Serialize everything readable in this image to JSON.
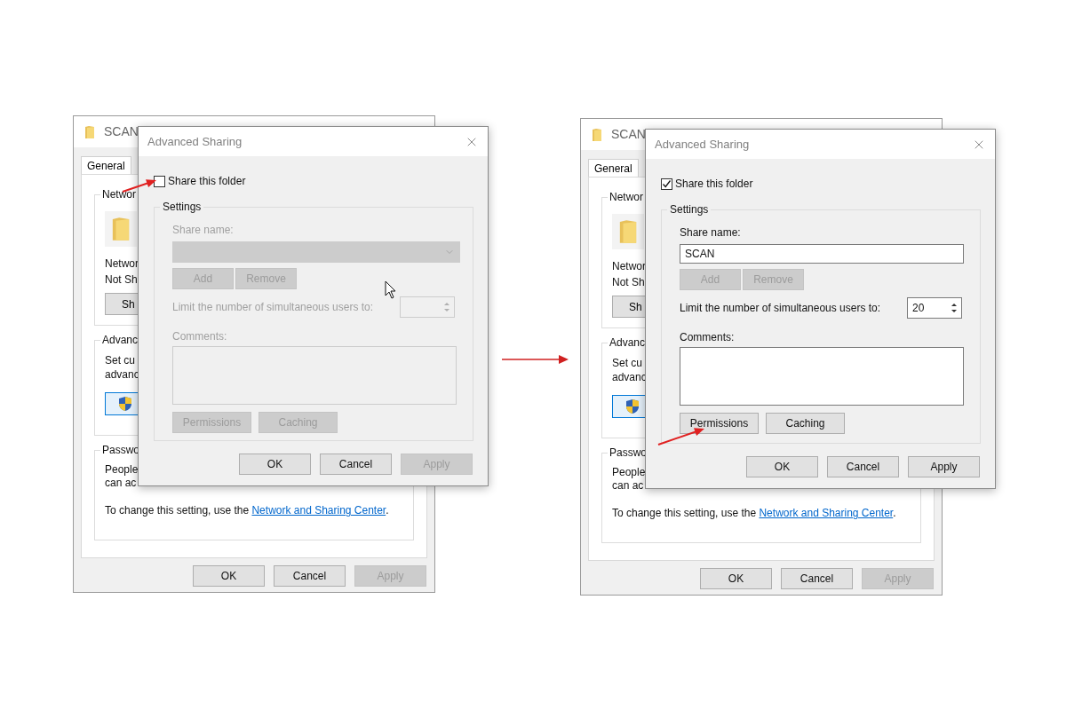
{
  "screenshots": [
    {
      "properties": {
        "title": "SCAN",
        "tab": {
          "label": "General",
          "selected": true
        },
        "network_group": {
          "legend": "Networ",
          "lines": [
            "Networ",
            "Not Sh"
          ],
          "button": "Sh"
        },
        "advanced_group": {
          "legend": "Advanc",
          "lines": [
            "Set cu",
            "advanc"
          ]
        },
        "password_group": {
          "legend": "Passwo",
          "lines": [
            "People",
            "can ac"
          ],
          "note": "To change this setting, use the ",
          "link": "Network and Sharing Center",
          "note_end": "."
        },
        "buttons": [
          {
            "label": "OK",
            "disabled": false
          },
          {
            "label": "Cancel",
            "disabled": false
          },
          {
            "label": "Apply",
            "disabled": true
          }
        ]
      },
      "dialog": {
        "title": "Advanced Sharing",
        "share_checkbox": {
          "label": "Share this folder",
          "checked": false
        },
        "settings": {
          "legend": "Settings",
          "disabled": true,
          "share_name": {
            "label": "Share name:",
            "kind": "combo"
          },
          "name_buttons": [
            {
              "label": "Add",
              "disabled": true
            },
            {
              "label": "Remove",
              "disabled": true
            }
          ],
          "limit": {
            "label": "Limit the number of simultaneous users to:"
          },
          "comments": {
            "label": "Comments:"
          },
          "buttons": [
            {
              "label": "Permissions",
              "disabled": true
            },
            {
              "label": "Caching",
              "disabled": true
            }
          ]
        },
        "buttons": [
          {
            "label": "OK",
            "disabled": false
          },
          {
            "label": "Cancel",
            "disabled": false
          },
          {
            "label": "Apply",
            "disabled": true
          }
        ]
      }
    },
    {
      "properties": {
        "title": "SCAN",
        "tab": {
          "label": "General",
          "selected": true
        },
        "network_group": {
          "legend": "Networ",
          "lines": [
            "Networ",
            "Not Sh"
          ],
          "button": "Sh"
        },
        "advanced_group": {
          "legend": "Advanc",
          "lines": [
            "Set cu",
            "advanc"
          ]
        },
        "password_group": {
          "legend": "Passwo",
          "lines": [
            "People",
            "can ac"
          ],
          "note": "To change this setting, use the ",
          "link": "Network and Sharing Center",
          "note_end": "."
        },
        "buttons": [
          {
            "label": "OK",
            "disabled": false
          },
          {
            "label": "Cancel",
            "disabled": false
          },
          {
            "label": "Apply",
            "disabled": true
          }
        ]
      },
      "dialog": {
        "title": "Advanced Sharing",
        "share_checkbox": {
          "label": "Share this folder",
          "checked": true
        },
        "settings": {
          "legend": "Settings",
          "disabled": false,
          "share_name": {
            "label": "Share name:",
            "kind": "text",
            "value": "SCAN"
          },
          "name_buttons": [
            {
              "label": "Add",
              "disabled": true
            },
            {
              "label": "Remove",
              "disabled": true
            }
          ],
          "limit": {
            "label": "Limit the number of simultaneous users to:",
            "value": "20"
          },
          "comments": {
            "label": "Comments:"
          },
          "buttons": [
            {
              "label": "Permissions",
              "disabled": false
            },
            {
              "label": "Caching",
              "disabled": false
            }
          ]
        },
        "buttons": [
          {
            "label": "OK",
            "disabled": false
          },
          {
            "label": "Cancel",
            "disabled": false
          },
          {
            "label": "Apply",
            "disabled": false
          }
        ]
      }
    }
  ]
}
